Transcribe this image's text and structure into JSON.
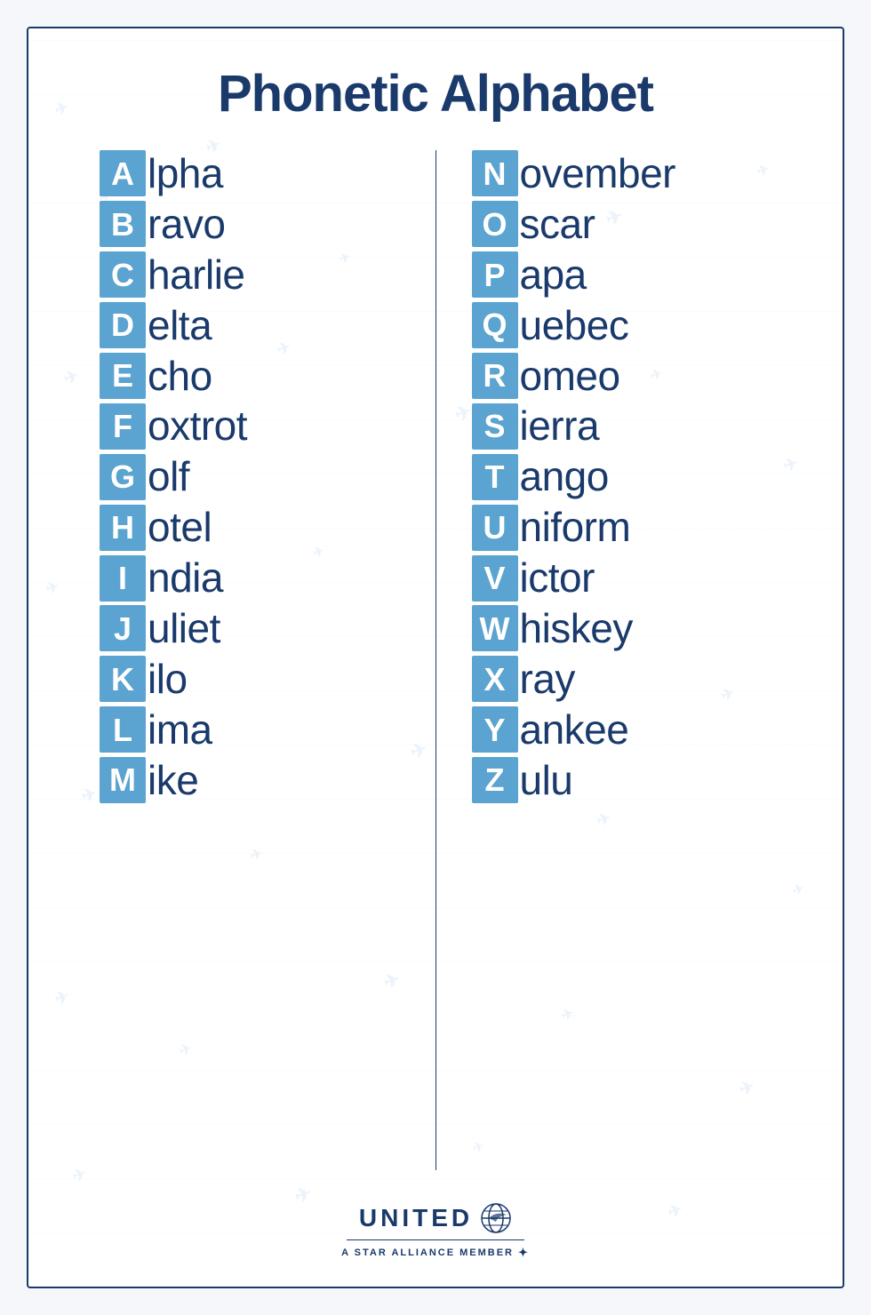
{
  "title": "Phonetic Alphabet",
  "left_column": [
    {
      "letter": "A",
      "word": "lpha"
    },
    {
      "letter": "B",
      "word": "ravo"
    },
    {
      "letter": "C",
      "word": "harlie"
    },
    {
      "letter": "D",
      "word": "elta"
    },
    {
      "letter": "E",
      "word": "cho"
    },
    {
      "letter": "F",
      "word": "oxtrot"
    },
    {
      "letter": "G",
      "word": "olf"
    },
    {
      "letter": "H",
      "word": "otel"
    },
    {
      "letter": "I",
      "word": "ndia"
    },
    {
      "letter": "J",
      "word": "uliet"
    },
    {
      "letter": "K",
      "word": "ilo"
    },
    {
      "letter": "L",
      "word": "ima"
    },
    {
      "letter": "M",
      "word": "ike"
    }
  ],
  "right_column": [
    {
      "letter": "N",
      "word": "ovember"
    },
    {
      "letter": "O",
      "word": "scar"
    },
    {
      "letter": "P",
      "word": "apa"
    },
    {
      "letter": "Q",
      "word": "uebec"
    },
    {
      "letter": "R",
      "word": "omeo"
    },
    {
      "letter": "S",
      "word": "ierra"
    },
    {
      "letter": "T",
      "word": "ango"
    },
    {
      "letter": "U",
      "word": "niform"
    },
    {
      "letter": "V",
      "word": "ictor"
    },
    {
      "letter": "W",
      "word": "hiskey"
    },
    {
      "letter": "X",
      "word": "ray"
    },
    {
      "letter": "Y",
      "word": "ankee"
    },
    {
      "letter": "Z",
      "word": "ulu"
    }
  ],
  "footer": {
    "brand": "UNITED",
    "tagline": "A STAR ALLIANCE MEMBER"
  },
  "colors": {
    "primary": "#1a3a6b",
    "accent": "#5ba3d0",
    "background": "#ffffff"
  }
}
